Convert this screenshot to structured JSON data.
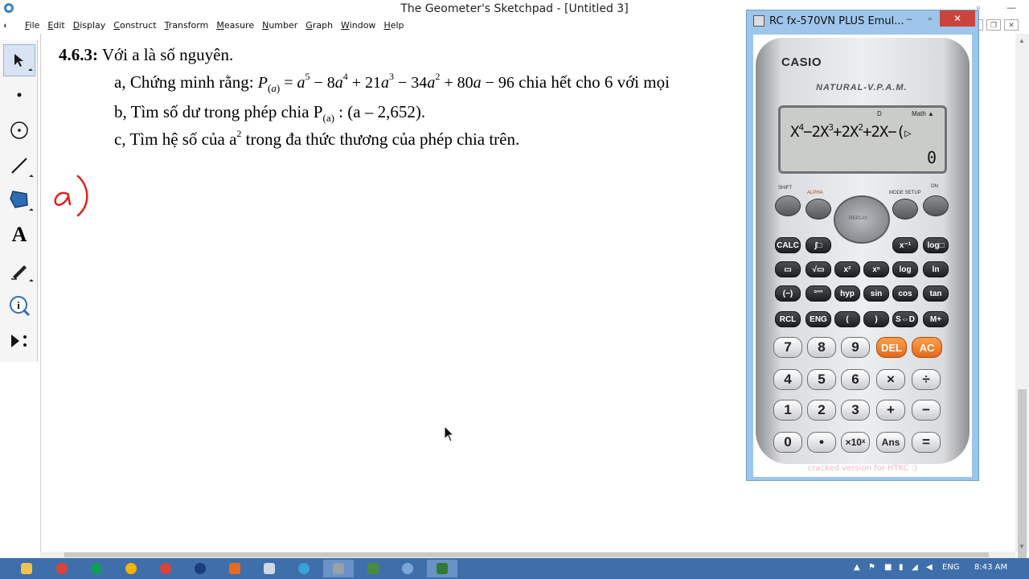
{
  "window": {
    "title": "The Geometer's Sketchpad - [Untitled 3]"
  },
  "menu": [
    {
      "pre": "",
      "u": "F",
      "post": "ile"
    },
    {
      "pre": "",
      "u": "E",
      "post": "dit"
    },
    {
      "pre": "",
      "u": "D",
      "post": "isplay"
    },
    {
      "pre": "",
      "u": "C",
      "post": "onstruct"
    },
    {
      "pre": "",
      "u": "T",
      "post": "ransform"
    },
    {
      "pre": "",
      "u": "M",
      "post": "easure"
    },
    {
      "pre": "",
      "u": "N",
      "post": "umber"
    },
    {
      "pre": "",
      "u": "G",
      "post": "raph"
    },
    {
      "pre": "",
      "u": "W",
      "post": "indow"
    },
    {
      "pre": "",
      "u": "H",
      "post": "elp"
    }
  ],
  "tools": [
    "arrow",
    "point",
    "compass",
    "straightedge",
    "polygon",
    "text",
    "marker",
    "information",
    "custom"
  ],
  "doc": {
    "problem_number": "4.6.3:",
    "intro": " Với a là số nguyên.",
    "line_a_prefix": "a, Chứng minh rằng: ",
    "line_a_suffix": " chia hết cho 6 với mọi",
    "line_b": "b, Tìm số dư trong phép chia P",
    "line_b_sub": "(a)",
    "line_b_rest": " : (a – 2,652).",
    "line_c_pre": "c, Tìm hệ số của a",
    "line_c_sup": "2",
    "line_c_post": " trong đa thức thương của phép chia trên.",
    "handwriting": "a)"
  },
  "calculator": {
    "window_title": "RC fx-570VN PLUS Emul...",
    "brand": "CASIO",
    "subtitle": "NATURAL-V.P.A.M.",
    "indicator_d": "D",
    "indicator_math": "Math ▲",
    "expression_parts": [
      "X",
      "4",
      "−2X",
      "3",
      "+2X",
      "2",
      "+2X−(",
      "▷"
    ],
    "result": "0",
    "footer": "cracked version for HTKC :)",
    "top_keys": {
      "shift": "SHIFT",
      "alpha": "ALPHA",
      "mode": "MODE SETUP",
      "on": "ON",
      "replay": "REPLAY"
    }
  },
  "taskbar": {
    "lang": "ENG",
    "time": "8:43 AM"
  }
}
